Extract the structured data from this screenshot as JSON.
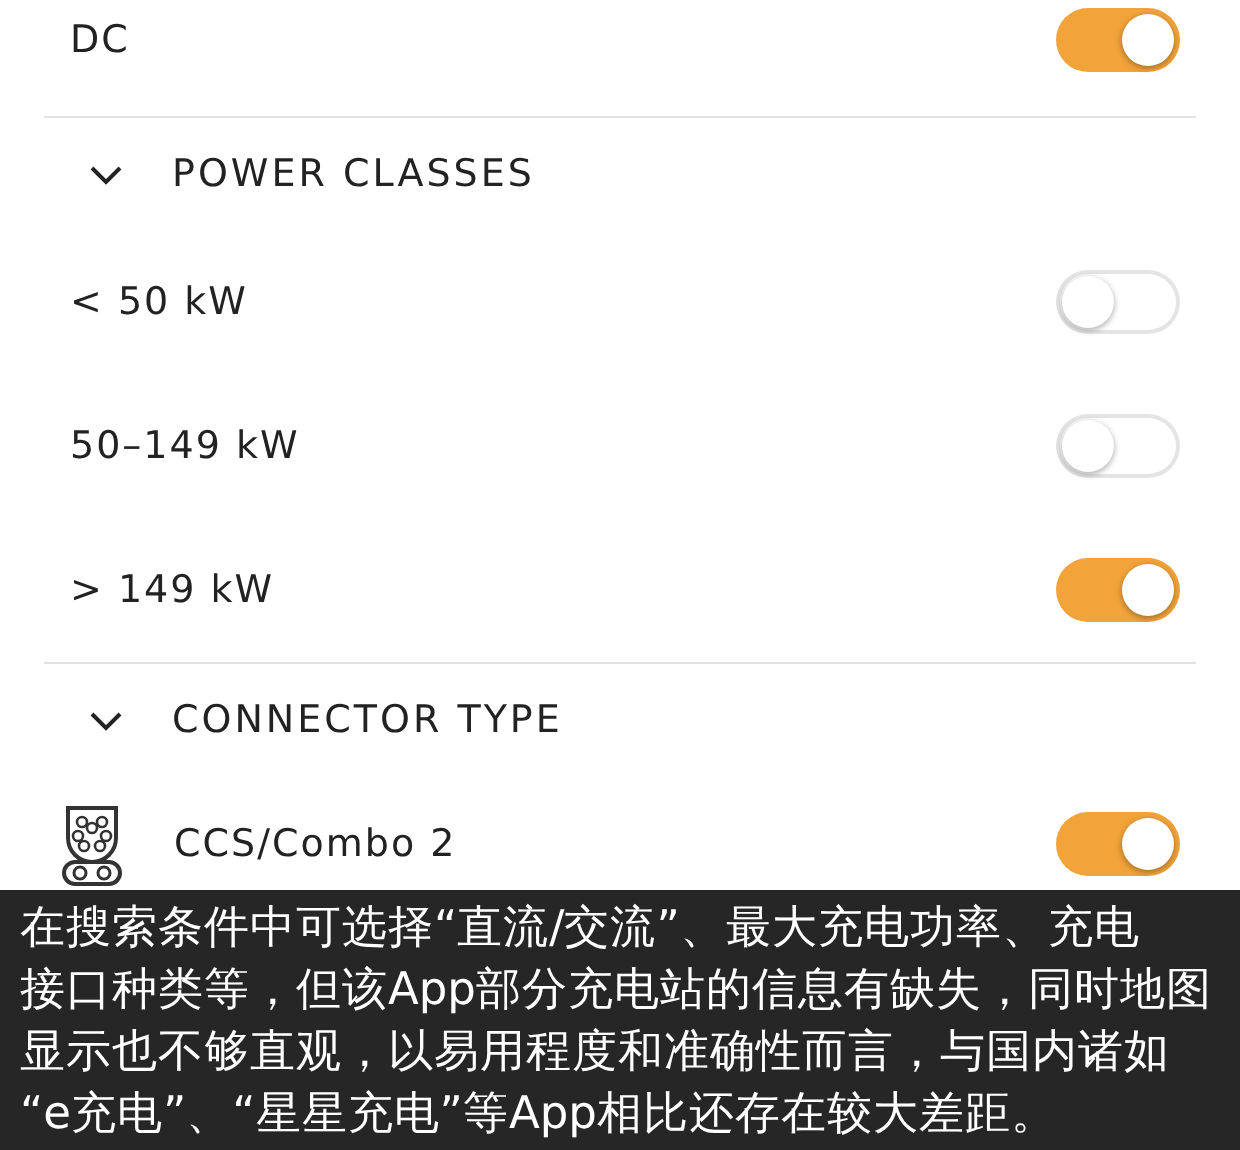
{
  "filters": [
    {
      "kind": "toggle",
      "label": "DC",
      "on": true
    },
    {
      "kind": "header",
      "label": "POWER CLASSES",
      "expanded": true
    },
    {
      "kind": "toggle",
      "label": "< 50 kW",
      "on": false
    },
    {
      "kind": "toggle",
      "label": "50–149 kW",
      "on": false
    },
    {
      "kind": "toggle",
      "label": "> 149 kW",
      "on": true
    },
    {
      "kind": "header",
      "label": "CONNECTOR TYPE",
      "expanded": true
    },
    {
      "kind": "connector",
      "label": "CCS/Combo 2",
      "on": true
    }
  ],
  "caption": {
    "lines": [
      "在搜索条件中可选择“直流/交流”、最大充电功率、充电",
      "接口种类等，但该App部分充电站的信息有缺失，同时地图",
      "显示也不够直观，以易用程度和准确性而言，与国内诸如",
      "“e充电”、“星星充电”等App相比还存在较大差距。"
    ]
  }
}
